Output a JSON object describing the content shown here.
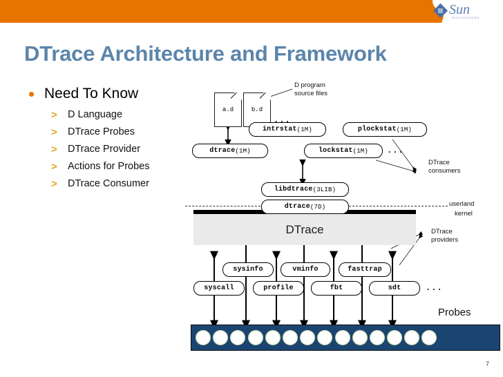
{
  "slide": {
    "title": "DTrace Architecture and Framework",
    "page_number": "7",
    "accent_orange": "#E87400",
    "title_blue": "#5B85AB"
  },
  "logo": {
    "word": "Sun",
    "subtitle": "microsystems"
  },
  "content": {
    "bullet": "Need To Know",
    "sub_items": [
      {
        "marker": ">",
        "label": "D Language"
      },
      {
        "marker": ">",
        "label": "DTrace Probes"
      },
      {
        "marker": ">",
        "label": "DTrace Provider"
      },
      {
        "marker": ">",
        "label": "Actions for Probes"
      },
      {
        "marker": ">",
        "label": "DTrace Consumer"
      }
    ]
  },
  "diagram": {
    "source_files": [
      {
        "name": "a.d"
      },
      {
        "name": "b.d"
      }
    ],
    "source_files_ellipsis": "...",
    "source_files_label": "D program\nsource files",
    "consumers_row1": [
      {
        "cmd": "intrstat",
        "suffix": "(1M)"
      },
      {
        "cmd": "plockstat",
        "suffix": "(1M)"
      }
    ],
    "consumers_row2": [
      {
        "cmd": "dtrace",
        "suffix": "(1M)"
      },
      {
        "cmd": "lockstat",
        "suffix": "(1M)"
      }
    ],
    "consumers_ellipsis": "...",
    "consumers_label": "DTrace\nconsumers",
    "library": {
      "cmd": "libdtrace",
      "suffix": "(3LIB)"
    },
    "driver": {
      "cmd": "dtrace",
      "suffix": "(7D)"
    },
    "boundary_upper": "userland",
    "boundary_lower": "kernel",
    "kernel_block": "DTrace",
    "providers_row1": [
      {
        "cmd": "sysinfo",
        "suffix": ""
      },
      {
        "cmd": "vminfo",
        "suffix": ""
      },
      {
        "cmd": "fasttrap",
        "suffix": ""
      }
    ],
    "providers_row2": [
      {
        "cmd": "syscall",
        "suffix": ""
      },
      {
        "cmd": "profile",
        "suffix": ""
      },
      {
        "cmd": "fbt",
        "suffix": ""
      },
      {
        "cmd": "sdt",
        "suffix": ""
      }
    ],
    "providers_ellipsis": "...",
    "providers_label": "DTrace\nproviders",
    "probes_label": "Probes",
    "probe_count": 14,
    "probe_bar_color": "#1B4571",
    "probe_ring_color": "#8FAE55"
  }
}
